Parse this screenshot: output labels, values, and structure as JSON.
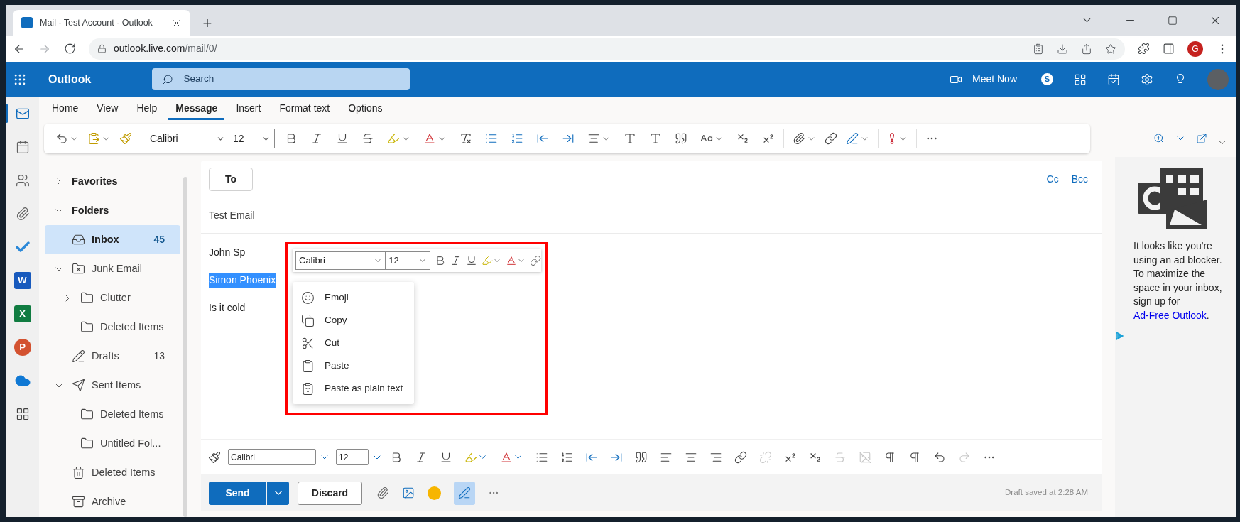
{
  "browser": {
    "tab_title": "Mail - Test Account - Outlook",
    "new_tab": "+",
    "url_host": "outlook.live.com",
    "url_path": "/mail/0/",
    "profile_initial": "G"
  },
  "app": {
    "name": "Outlook",
    "search_placeholder": "Search",
    "meet_now": "Meet Now",
    "skype_letter": "S"
  },
  "rail": [
    {
      "kind": "mail",
      "selected": true
    },
    {
      "kind": "calendar",
      "selected": false
    },
    {
      "kind": "people",
      "selected": false
    },
    {
      "kind": "files",
      "selected": false
    },
    {
      "kind": "todo",
      "selected": false
    },
    {
      "kind": "word",
      "letter": "W",
      "selected": false
    },
    {
      "kind": "excel",
      "letter": "X",
      "selected": false
    },
    {
      "kind": "powerpoint",
      "letter": "P",
      "selected": false
    },
    {
      "kind": "onedrive",
      "selected": false
    },
    {
      "kind": "apps",
      "selected": false
    }
  ],
  "ribbon": {
    "tabs": [
      {
        "label": "Home",
        "selected": false
      },
      {
        "label": "View",
        "selected": false
      },
      {
        "label": "Help",
        "selected": false
      },
      {
        "label": "Message",
        "selected": true
      },
      {
        "label": "Insert",
        "selected": false
      },
      {
        "label": "Format text",
        "selected": false
      },
      {
        "label": "Options",
        "selected": false
      }
    ],
    "font": "Calibri",
    "size": "12"
  },
  "folders": [
    {
      "label": "Favorites",
      "expanded": false,
      "selected": false
    },
    {
      "label": "Folders",
      "expanded": true,
      "selected": false,
      "children": [
        {
          "label": "Inbox",
          "kind": "inbox",
          "count": "45",
          "selected": true
        },
        {
          "label": "Junk Email",
          "kind": "junk",
          "expanded": true,
          "selected": false,
          "children": [
            {
              "label": "Clutter",
              "kind": "folder",
              "expanded": false,
              "selected": false
            },
            {
              "label": "Deleted Items",
              "kind": "folder",
              "selected": false
            }
          ]
        },
        {
          "label": "Drafts",
          "kind": "drafts",
          "count": "13",
          "selected": false
        },
        {
          "label": "Sent Items",
          "kind": "sent",
          "expanded": true,
          "selected": false,
          "children": [
            {
              "label": "Deleted Items",
              "kind": "folder",
              "selected": false
            },
            {
              "label": "Untitled Fol...",
              "kind": "folder",
              "selected": false
            }
          ]
        },
        {
          "label": "Deleted Items",
          "kind": "trash",
          "selected": false
        },
        {
          "label": "Archive",
          "kind": "archive",
          "selected": false
        }
      ]
    }
  ],
  "compose": {
    "to_label": "To",
    "cc": "Cc",
    "bcc": "Bcc",
    "subject": "Test Email",
    "body": [
      {
        "text": "John Sp",
        "selected": false
      },
      {
        "text": "Simon Phoenix",
        "selected": true
      },
      {
        "text": "Is it cold",
        "selected": false
      }
    ],
    "mini_toolbar": {
      "font": "Calibri",
      "size": "12"
    },
    "context_menu": [
      {
        "label": "Emoji",
        "kind": "emoji"
      },
      {
        "label": "Copy",
        "kind": "copy"
      },
      {
        "label": "Cut",
        "kind": "cut"
      },
      {
        "label": "Paste",
        "kind": "paste"
      },
      {
        "label": "Paste as plain text",
        "kind": "paste_plain"
      }
    ],
    "format_bar": {
      "font": "Calibri",
      "size": "12"
    },
    "send": "Send",
    "discard": "Discard",
    "editor_active": true,
    "status": "Draft saved at 2:28 AM"
  },
  "ad": {
    "text": "It looks like you're using an ad blocker. To maximize the space in your inbox, sign up for ",
    "link": "Ad-Free Outlook",
    "tail": "."
  }
}
